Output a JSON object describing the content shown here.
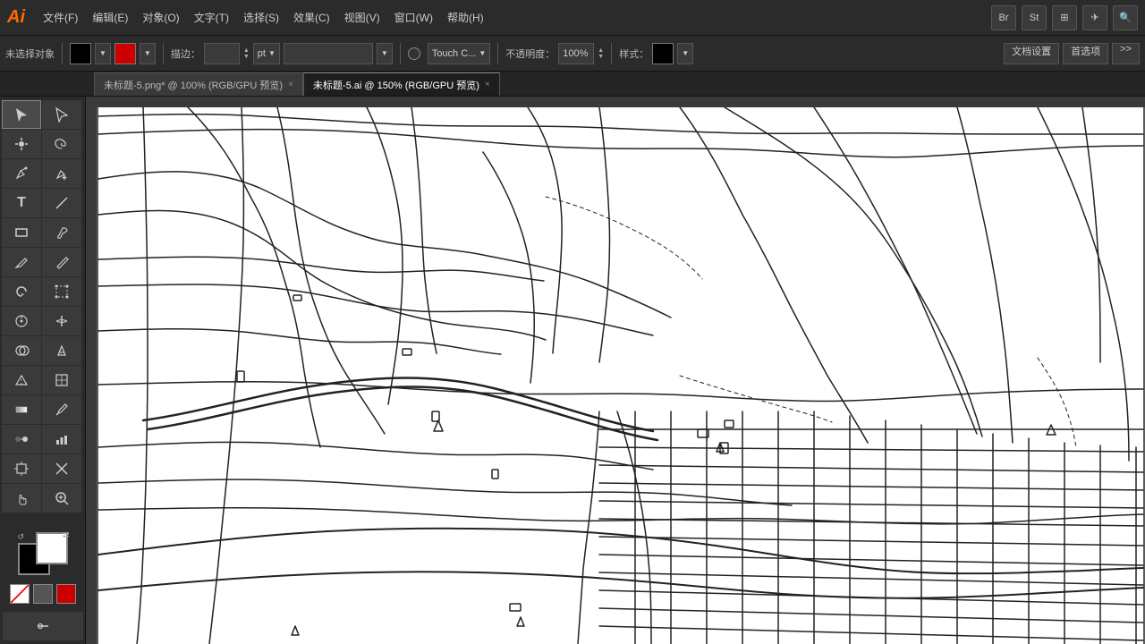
{
  "app": {
    "logo": "Ai",
    "logo_color": "#ff8c00"
  },
  "menu": {
    "items": [
      {
        "label": "文件(F)"
      },
      {
        "label": "编辑(E)"
      },
      {
        "label": "对象(O)"
      },
      {
        "label": "文字(T)"
      },
      {
        "label": "选择(S)"
      },
      {
        "label": "效果(C)"
      },
      {
        "label": "视图(V)"
      },
      {
        "label": "窗口(W)"
      },
      {
        "label": "帮助(H)"
      }
    ]
  },
  "toolbar": {
    "selection_label": "未选择对象",
    "stroke_label": "描边：",
    "touch_label": "Touch C...",
    "opacity_label": "不透明度：",
    "opacity_value": "100%",
    "style_label": "样式：",
    "doc_settings_label": "文档设置",
    "preferences_label": "首选项"
  },
  "tabs": [
    {
      "label": "未标题-5.png*  @  100% (RGB/GPU 预览)",
      "active": false
    },
    {
      "label": "未标题-5.ai  @  150% (RGB/GPU 预览)",
      "active": true
    }
  ],
  "tools": [
    {
      "name": "selection",
      "icon": "↖",
      "row": 0,
      "col": 0
    },
    {
      "name": "direct-selection",
      "icon": "↗",
      "row": 0,
      "col": 1
    },
    {
      "name": "magic-wand",
      "icon": "✦",
      "row": 1,
      "col": 0
    },
    {
      "name": "lasso",
      "icon": "⌒",
      "row": 1,
      "col": 1
    },
    {
      "name": "pen",
      "icon": "✒",
      "row": 2,
      "col": 0
    },
    {
      "name": "add-anchor",
      "icon": "+",
      "row": 2,
      "col": 1
    },
    {
      "name": "type",
      "icon": "T",
      "row": 3,
      "col": 0
    },
    {
      "name": "line",
      "icon": "╱",
      "row": 3,
      "col": 1
    },
    {
      "name": "rect",
      "icon": "□",
      "row": 4,
      "col": 0
    },
    {
      "name": "blob",
      "icon": "⬡",
      "row": 4,
      "col": 1
    },
    {
      "name": "pencil",
      "icon": "✏",
      "row": 5,
      "col": 0
    },
    {
      "name": "eraser",
      "icon": "◻",
      "row": 5,
      "col": 1
    },
    {
      "name": "rotate",
      "icon": "↻",
      "row": 6,
      "col": 0
    },
    {
      "name": "free-transform",
      "icon": "⊞",
      "row": 6,
      "col": 1
    },
    {
      "name": "puppet-warp",
      "icon": "✿",
      "row": 7,
      "col": 0
    },
    {
      "name": "width",
      "icon": "⟺",
      "row": 7,
      "col": 1
    },
    {
      "name": "shape-builder",
      "icon": "⊗",
      "row": 8,
      "col": 0
    },
    {
      "name": "live-paint",
      "icon": "⊙",
      "row": 8,
      "col": 1
    },
    {
      "name": "perspective-grid",
      "icon": "⬚",
      "row": 9,
      "col": 0
    },
    {
      "name": "mesh",
      "icon": "⊞",
      "row": 9,
      "col": 1
    },
    {
      "name": "gradient",
      "icon": "⬜",
      "row": 10,
      "col": 0
    },
    {
      "name": "eyedropper",
      "icon": "💧",
      "row": 10,
      "col": 1
    },
    {
      "name": "blend",
      "icon": "◈",
      "row": 11,
      "col": 0
    },
    {
      "name": "chart",
      "icon": "📊",
      "row": 11,
      "col": 1
    },
    {
      "name": "artboard",
      "icon": "▭",
      "row": 12,
      "col": 0
    },
    {
      "name": "slice",
      "icon": "⚔",
      "row": 12,
      "col": 1
    },
    {
      "name": "hand",
      "icon": "✋",
      "row": 13,
      "col": 0
    },
    {
      "name": "zoom",
      "icon": "🔍",
      "row": 13,
      "col": 1
    }
  ]
}
